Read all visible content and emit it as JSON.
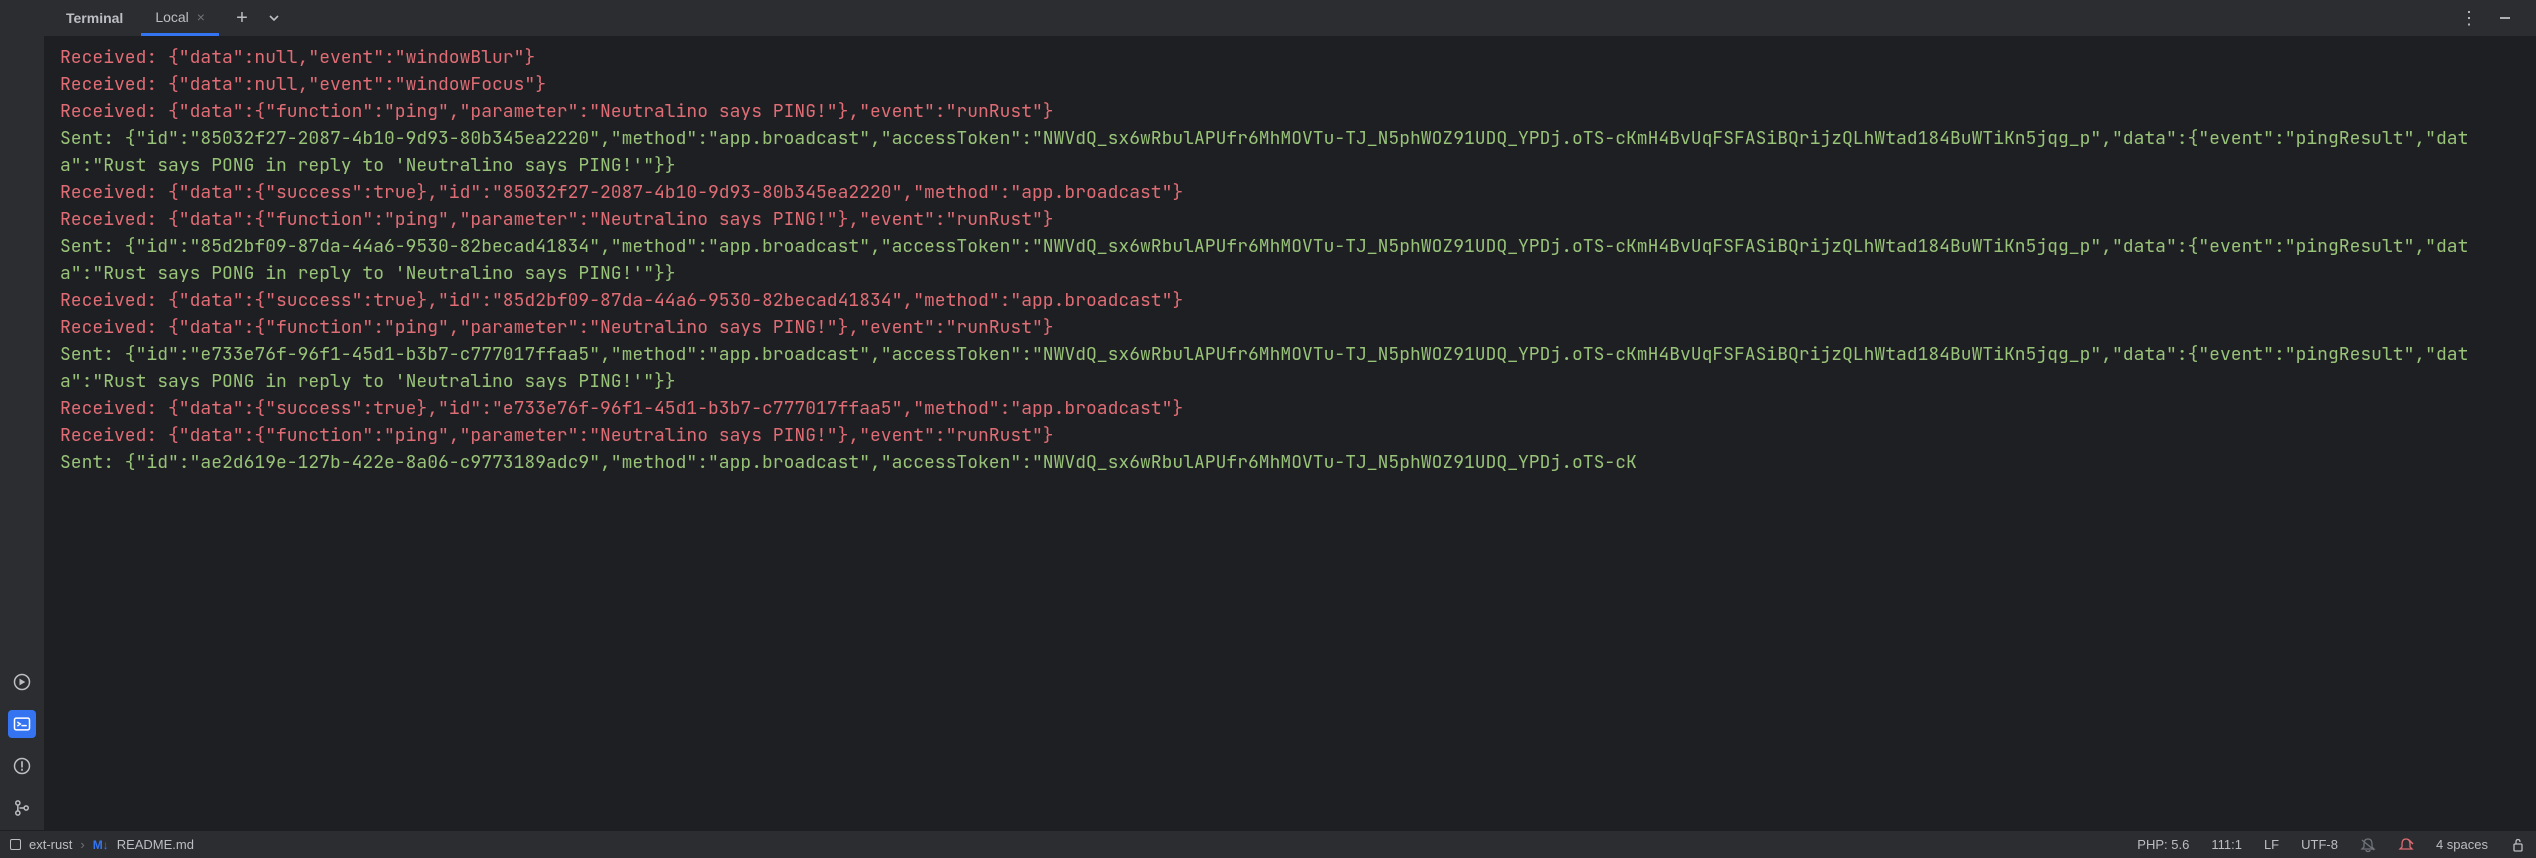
{
  "tabs": {
    "terminal": "Terminal",
    "local": "Local"
  },
  "log_lines": [
    {
      "type": "red",
      "text": "Received: {\"data\":null,\"event\":\"windowBlur\"}"
    },
    {
      "type": "red",
      "text": "Received: {\"data\":null,\"event\":\"windowFocus\"}"
    },
    {
      "type": "red",
      "text": "Received: {\"data\":{\"function\":\"ping\",\"parameter\":\"Neutralino says PING!\"},\"event\":\"runRust\"}"
    },
    {
      "type": "green",
      "text": "Sent: {\"id\":\"85032f27-2087-4b10-9d93-80b345ea2220\",\"method\":\"app.broadcast\",\"accessToken\":\"NWVdQ_sx6wRbulAPUfr6MhMOVTu-TJ_N5phWOZ91UDQ_YPDj.oTS-cKmH4BvUqFSFASiBQrijzQLhWtad184BuWTiKn5jqg_p\",\"data\":{\"event\":\"pingResult\",\"data\":\"Rust says PONG in reply to 'Neutralino says PING!'\"}}"
    },
    {
      "type": "red",
      "text": "Received: {\"data\":{\"success\":true},\"id\":\"85032f27-2087-4b10-9d93-80b345ea2220\",\"method\":\"app.broadcast\"}"
    },
    {
      "type": "red",
      "text": "Received: {\"data\":{\"function\":\"ping\",\"parameter\":\"Neutralino says PING!\"},\"event\":\"runRust\"}"
    },
    {
      "type": "green",
      "text": "Sent: {\"id\":\"85d2bf09-87da-44a6-9530-82becad41834\",\"method\":\"app.broadcast\",\"accessToken\":\"NWVdQ_sx6wRbulAPUfr6MhMOVTu-TJ_N5phWOZ91UDQ_YPDj.oTS-cKmH4BvUqFSFASiBQrijzQLhWtad184BuWTiKn5jqg_p\",\"data\":{\"event\":\"pingResult\",\"data\":\"Rust says PONG in reply to 'Neutralino says PING!'\"}}"
    },
    {
      "type": "red",
      "text": "Received: {\"data\":{\"success\":true},\"id\":\"85d2bf09-87da-44a6-9530-82becad41834\",\"method\":\"app.broadcast\"}"
    },
    {
      "type": "red",
      "text": "Received: {\"data\":{\"function\":\"ping\",\"parameter\":\"Neutralino says PING!\"},\"event\":\"runRust\"}"
    },
    {
      "type": "green",
      "text": "Sent: {\"id\":\"e733e76f-96f1-45d1-b3b7-c777017ffaa5\",\"method\":\"app.broadcast\",\"accessToken\":\"NWVdQ_sx6wRbulAPUfr6MhMOVTu-TJ_N5phWOZ91UDQ_YPDj.oTS-cKmH4BvUqFSFASiBQrijzQLhWtad184BuWTiKn5jqg_p\",\"data\":{\"event\":\"pingResult\",\"data\":\"Rust says PONG in reply to 'Neutralino says PING!'\"}}"
    },
    {
      "type": "red",
      "text": "Received: {\"data\":{\"success\":true},\"id\":\"e733e76f-96f1-45d1-b3b7-c777017ffaa5\",\"method\":\"app.broadcast\"}"
    },
    {
      "type": "red",
      "text": "Received: {\"data\":{\"function\":\"ping\",\"parameter\":\"Neutralino says PING!\"},\"event\":\"runRust\"}"
    },
    {
      "type": "green",
      "text": "Sent: {\"id\":\"ae2d619e-127b-422e-8a06-c9773189adc9\",\"method\":\"app.broadcast\",\"accessToken\":\"NWVdQ_sx6wRbulAPUfr6MhMOVTu-TJ_N5phWOZ91UDQ_YPDj.oTS-cK"
    }
  ],
  "breadcrumb": {
    "project": "ext-rust",
    "file": "README.md"
  },
  "status": {
    "php": "PHP: 5.6",
    "position": "111:1",
    "line_ending": "LF",
    "encoding": "UTF-8",
    "indent": "4 spaces"
  }
}
